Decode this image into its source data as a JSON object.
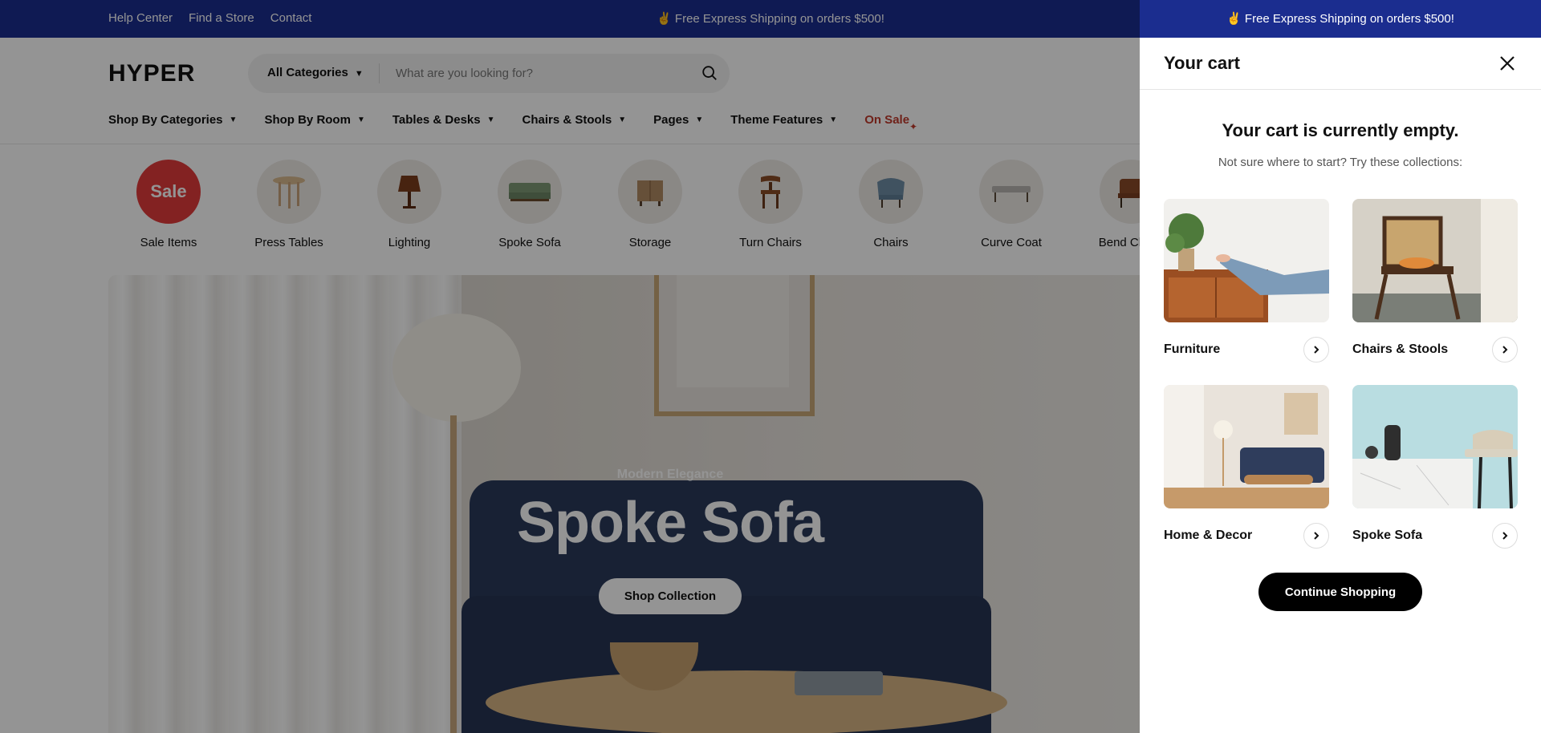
{
  "topbar": {
    "links": [
      "Help Center",
      "Find a Store",
      "Contact"
    ],
    "promo": "✌️ Free Express Shipping on orders $500!"
  },
  "header": {
    "logo": "HYPER",
    "search": {
      "category": "All Categories",
      "placeholder": "What are you looking for?"
    },
    "nav": [
      "Shop By Categories",
      "Shop By Room",
      "Tables & Desks",
      "Chairs & Stools",
      "Pages",
      "Theme Features",
      "On Sale"
    ]
  },
  "categories": [
    {
      "label": "Sale Items",
      "badge": "Sale"
    },
    {
      "label": "Press Tables"
    },
    {
      "label": "Lighting"
    },
    {
      "label": "Spoke Sofa"
    },
    {
      "label": "Storage"
    },
    {
      "label": "Turn Chairs"
    },
    {
      "label": "Chairs"
    },
    {
      "label": "Curve Coat"
    },
    {
      "label": "Bend Chairs"
    }
  ],
  "hero": {
    "subtitle": "Modern Elegance",
    "title": "Spoke Sofa",
    "cta": "Shop Collection"
  },
  "cart": {
    "promo": "✌️ Free Express Shipping on orders $500!",
    "title": "Your cart",
    "empty_title": "Your cart is currently empty.",
    "empty_sub": "Not sure where to start? Try these collections:",
    "collections": [
      {
        "name": "Furniture"
      },
      {
        "name": "Chairs & Stools"
      },
      {
        "name": "Home & Decor"
      },
      {
        "name": "Spoke Sofa"
      }
    ],
    "continue": "Continue Shopping"
  },
  "colors": {
    "topbar": "#1b2d8f",
    "sale": "#e23b3b",
    "accent_dark": "#000000"
  }
}
